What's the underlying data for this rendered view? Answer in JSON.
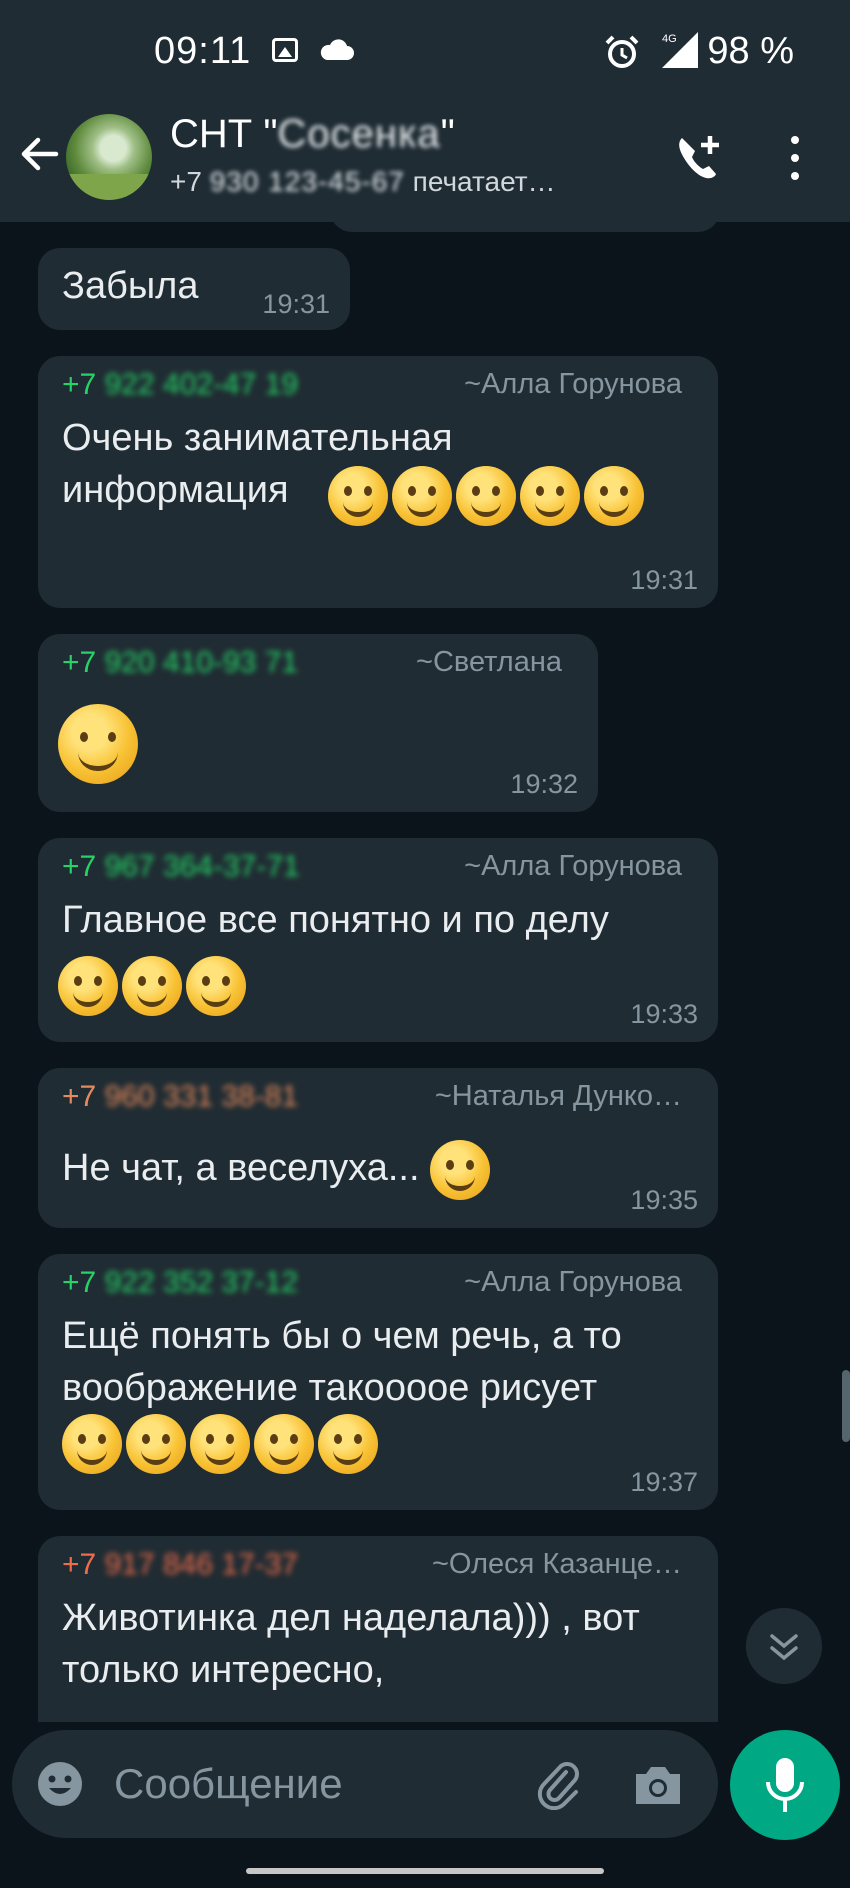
{
  "status_bar": {
    "time": "09:11",
    "network": "4G",
    "battery": "98 %"
  },
  "header": {
    "group_name": "СНТ \"",
    "group_name_hidden": "Сосенка",
    "group_name_end": "\"",
    "subtitle_prefix": "+7",
    "subtitle_hidden": "930 123-45-67",
    "typing_text": "печатает…"
  },
  "messages": [
    {
      "text": "Забыла",
      "time": "19:31"
    },
    {
      "phone_prefix": "+7",
      "phone_hidden": "922 402-47 19",
      "sender_color": "#25d366",
      "author": "~Алла Горунова",
      "text": "Очень занимательная информация",
      "emoji_count": 5,
      "time": "19:31"
    },
    {
      "phone_prefix": "+7",
      "phone_hidden": "920 410-93 71",
      "sender_color": "#25d366",
      "author": "~Светлана",
      "text": "",
      "emoji_count": 1,
      "time": "19:32"
    },
    {
      "phone_prefix": "+7",
      "phone_hidden": "967 364-37-71",
      "sender_color": "#25d366",
      "author": "~Алла Горунова",
      "text": "Главное все понятно и по делу",
      "emoji_count": 3,
      "time": "19:33"
    },
    {
      "phone_prefix": "+7",
      "phone_hidden": "960 331 38-81",
      "sender_color": "#e58a5b",
      "author": "~Наталья Дунко…",
      "text": "Не чат, а веселуха...",
      "emoji_count": 1,
      "time": "19:35"
    },
    {
      "phone_prefix": "+7",
      "phone_hidden": "922 352 37-12",
      "sender_color": "#25d366",
      "author": "~Алла Горунова",
      "text": "Ещё понять бы о чем речь, а то воображение такоооое рисует",
      "emoji_count": 5,
      "time": "19:37"
    },
    {
      "phone_prefix": "+7",
      "phone_hidden": "917 846 17-37",
      "sender_color": "#ef6c4a",
      "author": "~Олеся Казанце…",
      "text": "Животинка дел наделала))) , вот только интересно,",
      "emoji_count": 0,
      "time": ""
    }
  ],
  "input": {
    "placeholder": "Сообщение"
  },
  "icons": [
    "back-arrow-icon",
    "add-call-icon",
    "more-vert-icon",
    "emoji-icon",
    "attach-icon",
    "camera-icon",
    "mic-icon",
    "chevron-down-icon"
  ],
  "colors": {
    "background": "#0b141a",
    "header": "#1f2c34",
    "bubble": "#202c33",
    "accent": "#00a884",
    "sender_green": "#25d366",
    "sender_orange": "#e58a5b"
  }
}
